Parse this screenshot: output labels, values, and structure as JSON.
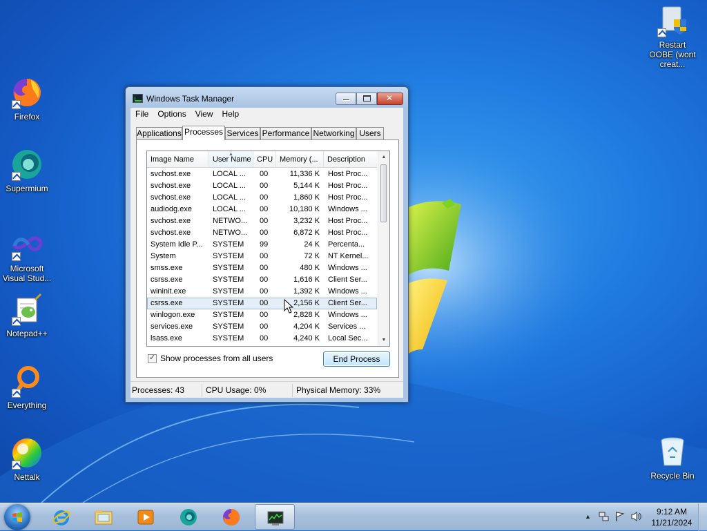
{
  "desktop": {
    "icons": [
      {
        "label": "Firefox",
        "icon": "firefox-icon"
      },
      {
        "label": "Supermium",
        "icon": "supermium-icon"
      },
      {
        "label": "Microsoft Visual Stud...",
        "icon": "visual-studio-icon"
      },
      {
        "label": "Notepad++",
        "icon": "notepad-plus-plus-icon"
      },
      {
        "label": "Everything",
        "icon": "everything-search-icon"
      },
      {
        "label": "Nettalk",
        "icon": "nettalk-icon"
      },
      {
        "label": "Restart OOBE (wont creat...",
        "icon": "restart-oobe-icon"
      },
      {
        "label": "Recycle Bin",
        "icon": "recycle-bin-icon"
      }
    ]
  },
  "window": {
    "title": "Windows Task Manager",
    "menu": [
      "File",
      "Options",
      "View",
      "Help"
    ],
    "tabs": [
      "Applications",
      "Processes",
      "Services",
      "Performance",
      "Networking",
      "Users"
    ],
    "active_tab": "Processes",
    "columns": [
      "Image Name",
      "User Name",
      "CPU",
      "Memory (...",
      "Description"
    ],
    "sorted_column": "User Name",
    "rows": [
      {
        "name": "svchost.exe",
        "user": "LOCAL ...",
        "cpu": "00",
        "mem": "11,336 K",
        "desc": "Host Proc..."
      },
      {
        "name": "svchost.exe",
        "user": "LOCAL ...",
        "cpu": "00",
        "mem": "5,144 K",
        "desc": "Host Proc..."
      },
      {
        "name": "svchost.exe",
        "user": "LOCAL ...",
        "cpu": "00",
        "mem": "1,860 K",
        "desc": "Host Proc..."
      },
      {
        "name": "audiodg.exe",
        "user": "LOCAL ...",
        "cpu": "00",
        "mem": "10,180 K",
        "desc": "Windows ..."
      },
      {
        "name": "svchost.exe",
        "user": "NETWO...",
        "cpu": "00",
        "mem": "3,232 K",
        "desc": "Host Proc..."
      },
      {
        "name": "svchost.exe",
        "user": "NETWO...",
        "cpu": "00",
        "mem": "6,872 K",
        "desc": "Host Proc..."
      },
      {
        "name": "System Idle P...",
        "user": "SYSTEM",
        "cpu": "99",
        "mem": "24 K",
        "desc": "Percenta..."
      },
      {
        "name": "System",
        "user": "SYSTEM",
        "cpu": "00",
        "mem": "72 K",
        "desc": "NT Kernel..."
      },
      {
        "name": "smss.exe",
        "user": "SYSTEM",
        "cpu": "00",
        "mem": "480 K",
        "desc": "Windows ..."
      },
      {
        "name": "csrss.exe",
        "user": "SYSTEM",
        "cpu": "00",
        "mem": "1,616 K",
        "desc": "Client Ser..."
      },
      {
        "name": "wininit.exe",
        "user": "SYSTEM",
        "cpu": "00",
        "mem": "1,392 K",
        "desc": "Windows ..."
      },
      {
        "name": "csrss.exe",
        "user": "SYSTEM",
        "cpu": "00",
        "mem": "2,156 K",
        "desc": "Client Ser...",
        "selected": true
      },
      {
        "name": "winlogon.exe",
        "user": "SYSTEM",
        "cpu": "00",
        "mem": "2,828 K",
        "desc": "Windows ..."
      },
      {
        "name": "services.exe",
        "user": "SYSTEM",
        "cpu": "00",
        "mem": "4,204 K",
        "desc": "Services ..."
      },
      {
        "name": "lsass.exe",
        "user": "SYSTEM",
        "cpu": "00",
        "mem": "4,240 K",
        "desc": "Local Sec..."
      }
    ],
    "show_all_label": "Show processes from all users",
    "show_all_checked": true,
    "end_process_label": "End Process",
    "status": {
      "processes": "Processes: 43",
      "cpu": "CPU Usage: 0%",
      "memory": "Physical Memory: 33%"
    }
  },
  "taskbar": {
    "pinned": [
      {
        "icon": "internet-explorer-icon"
      },
      {
        "icon": "file-explorer-icon"
      },
      {
        "icon": "media-player-icon"
      },
      {
        "icon": "supermium-icon"
      },
      {
        "icon": "firefox-icon"
      },
      {
        "icon": "task-manager-icon",
        "active": true
      }
    ],
    "clock_time": "9:12 AM",
    "clock_date": "11/21/2024"
  },
  "colors": {
    "wallpaper": "#1f7ae0",
    "selection": "#e3eef9",
    "window_frame": "#a9c4e4"
  }
}
